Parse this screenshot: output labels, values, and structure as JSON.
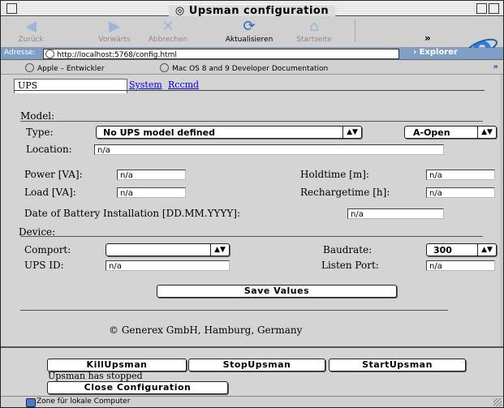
{
  "window": {
    "title": "Upsman configuration"
  },
  "toolbar": {
    "back": "Zurück",
    "forward": "Vorwärts",
    "stop": "Abbrechen",
    "refresh": "Aktualisieren",
    "home": "Startseite",
    "more": "»"
  },
  "address": {
    "label": "Adresse:",
    "url": "http://localhost:5768/config.html",
    "explorer": "Explorer"
  },
  "favorites": {
    "item1": "Apple – Entwickler",
    "item2": "Mac OS 8 and 9 Developer Documentation",
    "more": "»"
  },
  "tabs": {
    "ups": "UPS",
    "system": "System",
    "rccmd": "Rccmd"
  },
  "model": {
    "heading": "Model:",
    "type_label": "Type:",
    "type_value": "No UPS model defined",
    "open_value": "A-Open",
    "location_label": "Location:",
    "location_value": "n/a",
    "power_label": "Power [VA]:",
    "power_value": "n/a",
    "holdtime_label": "Holdtime [m]:",
    "holdtime_value": "n/a",
    "load_label": "Load [VA]:",
    "load_value": "n/a",
    "recharge_label": "Rechargetime [h]:",
    "recharge_value": "n/a",
    "battery_label": "Date of Battery Installation [DD.MM.YYYY]:",
    "battery_value": "n/a"
  },
  "device": {
    "heading": "Device:",
    "comport_label": "Comport:",
    "comport_value": "",
    "baudrate_label": "Baudrate:",
    "baudrate_value": "300",
    "upsid_label": "UPS ID:",
    "upsid_value": "n/a",
    "listen_label": "Listen Port:",
    "listen_value": "n/a"
  },
  "save_button": "Save Values",
  "footer": "© Generex GmbH, Hamburg, Germany",
  "controls": {
    "kill": "KillUpsman",
    "stop": "StopUpsman",
    "start": "StartUpsman",
    "status": "Upsman has stopped",
    "close": "Close Configuration"
  },
  "statusbar": {
    "zone": "Zone für lokale Computer"
  },
  "colors": {
    "address_bar": "#7f9fc6",
    "ie_logo": "#2f7fd8",
    "link": "#0000ee"
  }
}
